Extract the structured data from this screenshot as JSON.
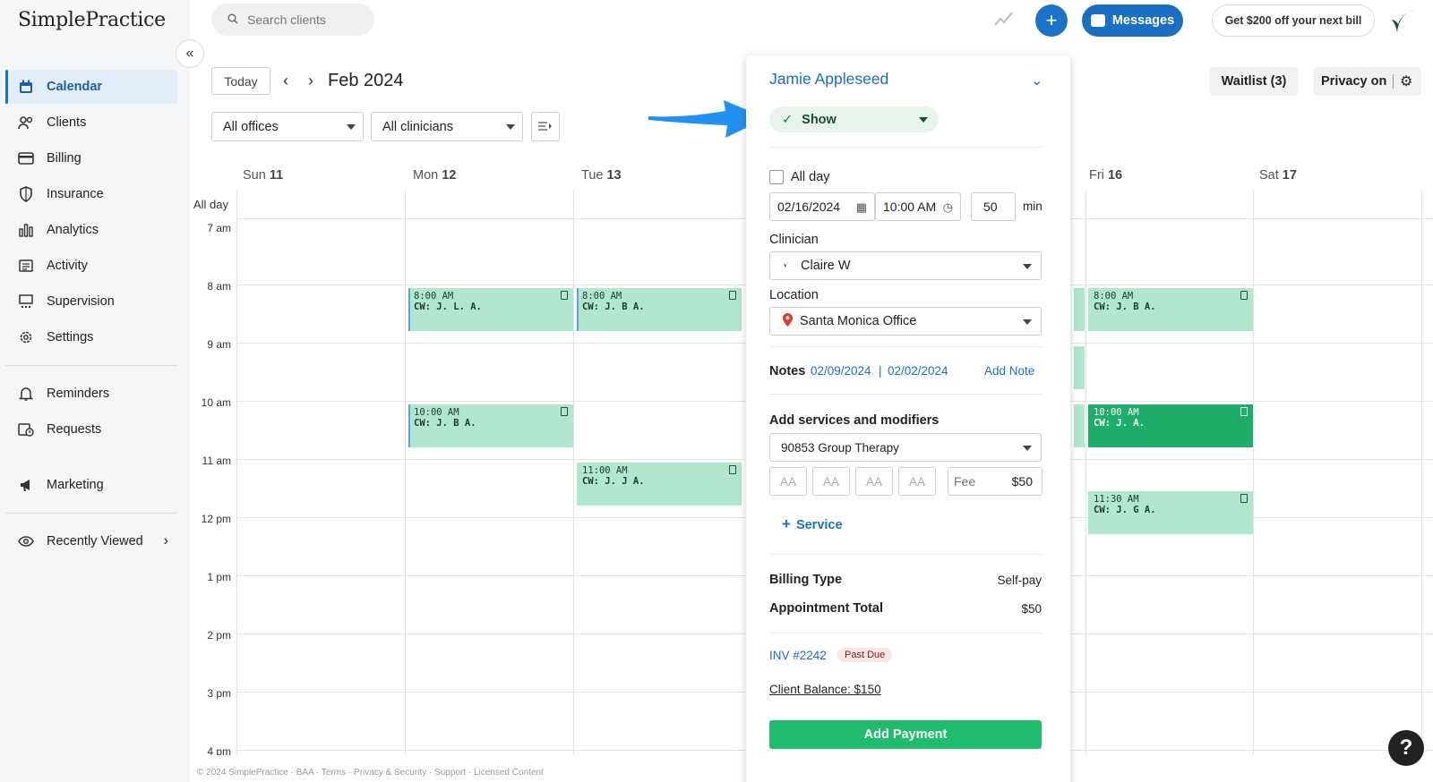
{
  "app": {
    "logo": "SimplePractice"
  },
  "sidebar": {
    "items": [
      {
        "label": "Calendar",
        "icon": "calendar-icon",
        "active": true
      },
      {
        "label": "Clients",
        "icon": "users-icon"
      },
      {
        "label": "Billing",
        "icon": "credit-card-icon"
      },
      {
        "label": "Insurance",
        "icon": "shield-icon"
      },
      {
        "label": "Analytics",
        "icon": "bar-chart-icon"
      },
      {
        "label": "Activity",
        "icon": "list-icon"
      },
      {
        "label": "Supervision",
        "icon": "supervision-icon"
      },
      {
        "label": "Settings",
        "icon": "gear-icon"
      }
    ],
    "secondary": [
      {
        "label": "Reminders",
        "icon": "bell-icon"
      },
      {
        "label": "Requests",
        "icon": "calendar-clock-icon"
      }
    ],
    "marketing": {
      "label": "Marketing",
      "icon": "megaphone-icon"
    },
    "recent": {
      "label": "Recently Viewed",
      "icon": "eye-icon"
    }
  },
  "topbar": {
    "search_placeholder": "Search clients",
    "messages_label": "Messages",
    "promo_label": "Get $200 off your next bill"
  },
  "calendar": {
    "today_label": "Today",
    "month": "Feb 2024",
    "office_filter": "All offices",
    "clinician_filter": "All clinicians",
    "waitlist_label": "Waitlist (3)",
    "privacy_label": "Privacy on",
    "allday_label": "All day",
    "days": [
      {
        "name": "Sun",
        "num": "11"
      },
      {
        "name": "Mon",
        "num": "12"
      },
      {
        "name": "Tue",
        "num": "13"
      },
      {
        "name": "Fri",
        "num": "16"
      },
      {
        "name": "Sat",
        "num": "17"
      }
    ],
    "times": [
      "7 am",
      "8 am",
      "9 am",
      "10 am",
      "11 am",
      "12 pm",
      "1 pm",
      "2 pm",
      "3 pm",
      "4 pm"
    ],
    "events": [
      {
        "time": "8:00 AM",
        "client": "CW: J. L. A."
      },
      {
        "time": "8:00 AM",
        "client": "CW: J. B A."
      },
      {
        "time": "8:00 AM",
        "client": "CW: J. B A."
      },
      {
        "time": "10:00 AM",
        "client": "CW: J. B A."
      },
      {
        "time": "10:00 AM",
        "client": "CW: J. A."
      },
      {
        "time": "11:00 AM",
        "client": "CW: J. J A."
      },
      {
        "time": "11:30 AM",
        "client": "CW: J. G A."
      }
    ]
  },
  "footer": "© 2024 SimplePractice · BAA · Terms · Privacy & Security · Support · Licensed Content",
  "appointment": {
    "client_name": "Jamie Appleseed",
    "status": "Show",
    "allday_label": "All day",
    "date": "02/16/2024",
    "time": "10:00 AM",
    "duration": "50",
    "duration_unit": "min",
    "clinician_label": "Clinician",
    "clinician": "Claire W",
    "location_label": "Location",
    "location": "Santa Monica Office",
    "notes_label": "Notes",
    "note_1": "02/09/2024",
    "note_sep": "|",
    "note_2": "02/02/2024",
    "add_note": "Add Note",
    "services_label": "Add services and modifiers",
    "service": "90853 Group Therapy",
    "modifiers": [
      "AA",
      "AA",
      "AA",
      "AA"
    ],
    "fee_label": "Fee",
    "fee_value": "$50",
    "add_service": "Service",
    "billing_type_label": "Billing Type",
    "billing_type": "Self-pay",
    "total_label": "Appointment Total",
    "total": "$50",
    "invoice": "INV #2242",
    "invoice_status": "Past Due",
    "balance": "Client Balance: $150",
    "add_payment": "Add Payment"
  }
}
